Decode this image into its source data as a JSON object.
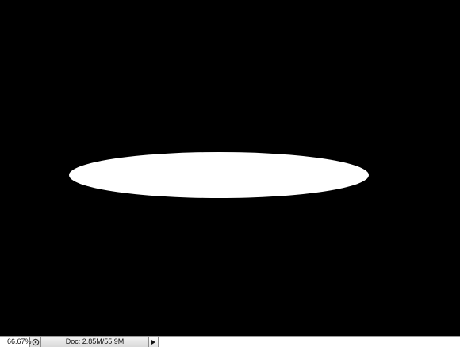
{
  "canvas": {
    "background_color": "#000000",
    "shape": "white-ellipse",
    "shape_color": "#ffffff"
  },
  "statusbar": {
    "zoom_level": "66.67%",
    "status_icon": "proof-setup-icon",
    "doc_info": "Doc: 2.85M/55.9M",
    "menu_arrow_icon": "triangle-right-icon"
  }
}
